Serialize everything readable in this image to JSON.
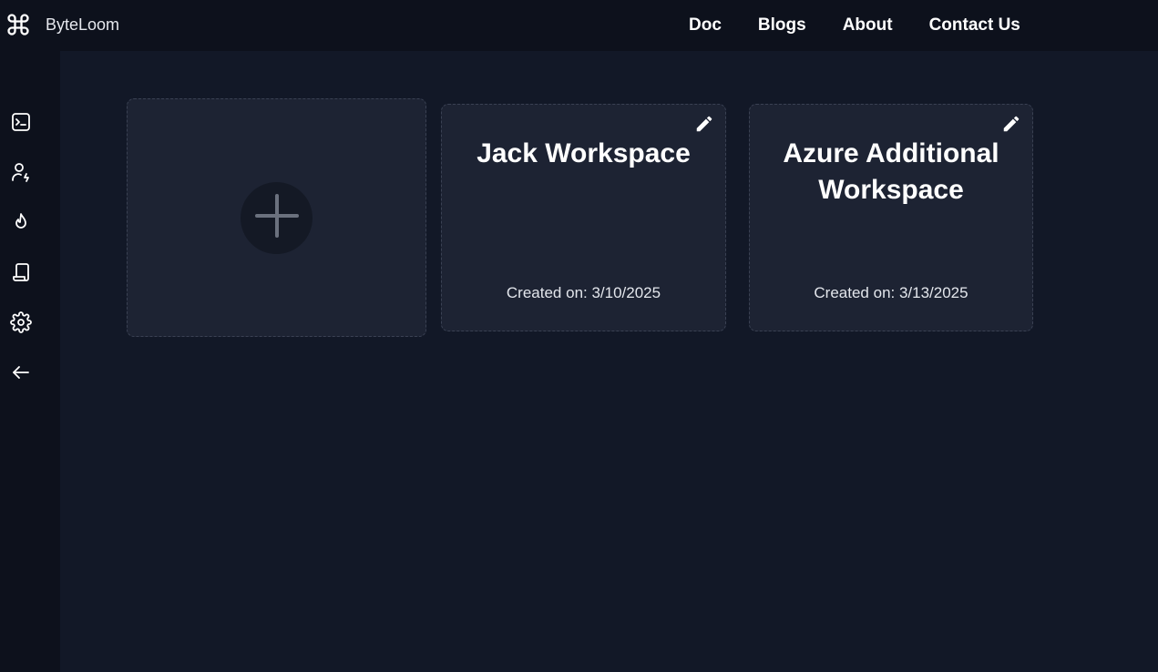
{
  "app": {
    "name": "ByteLoom",
    "logo_icon": "command-icon"
  },
  "nav": {
    "links": [
      {
        "label": "Doc"
      },
      {
        "label": "Blogs"
      },
      {
        "label": "About"
      },
      {
        "label": "Contact Us"
      }
    ]
  },
  "sidebar": {
    "items": [
      {
        "icon": "terminal-icon"
      },
      {
        "icon": "user-bolt-icon"
      },
      {
        "icon": "flame-icon"
      },
      {
        "icon": "scroll-icon"
      },
      {
        "icon": "gear-icon"
      },
      {
        "icon": "arrow-left-icon"
      }
    ]
  },
  "workspaces": {
    "add_icon": "plus-icon",
    "items": [
      {
        "title": "Jack Workspace",
        "created": "Created on: 3/10/2025",
        "edit_icon": "pencil-icon"
      },
      {
        "title": "Azure Additional Workspace",
        "created": "Created on: 3/13/2025",
        "edit_icon": "pencil-icon"
      }
    ]
  },
  "colors": {
    "background": "#121827",
    "topbar": "#0d111c",
    "card": "#1d2333",
    "card_border": "#3a4153",
    "text": "#ffffff"
  }
}
